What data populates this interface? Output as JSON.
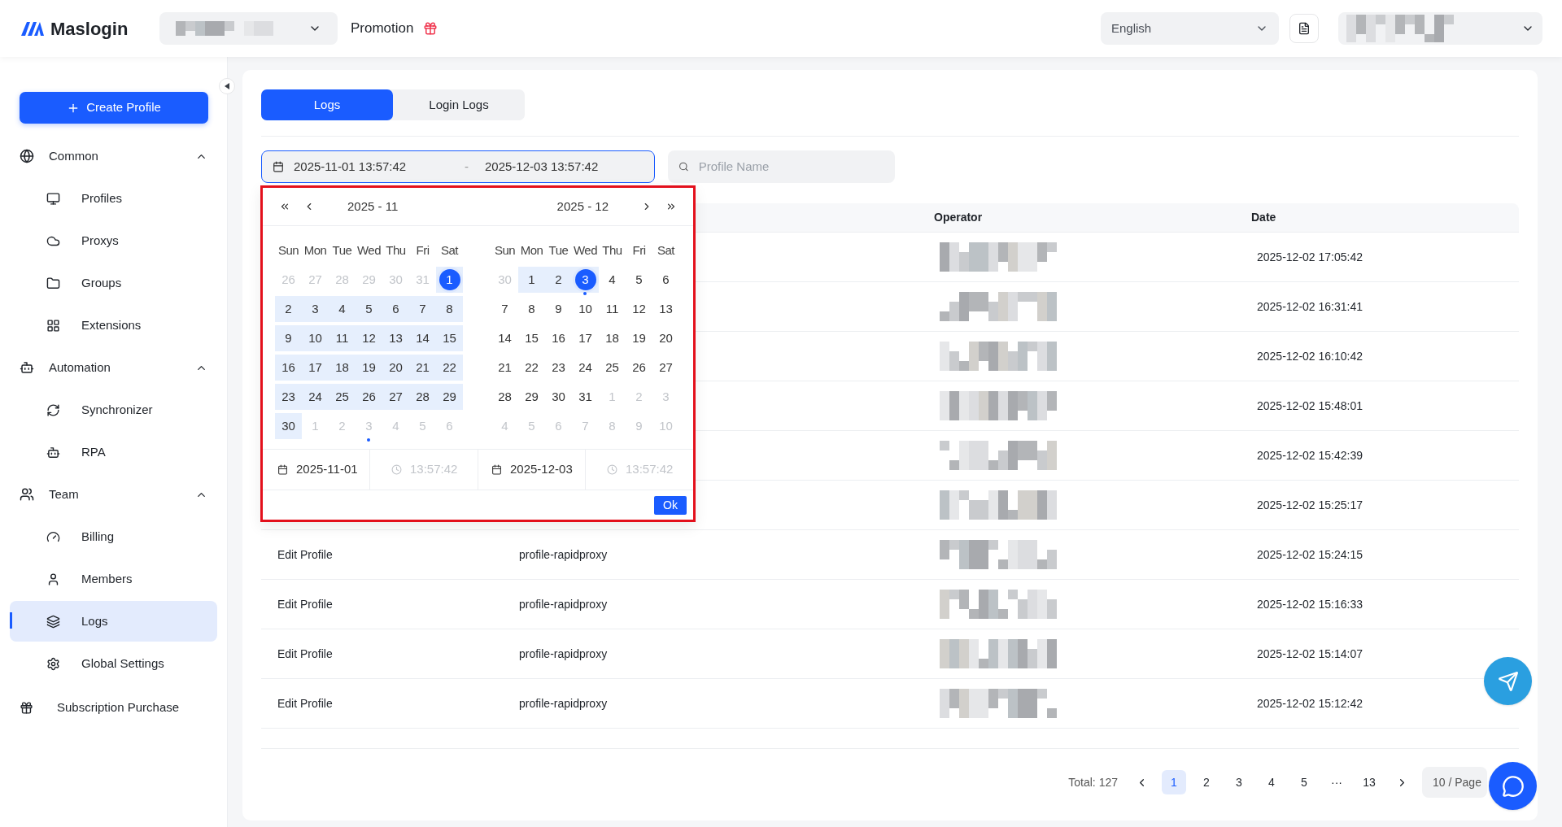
{
  "brand": "Maslogin",
  "header": {
    "promotion": "Promotion",
    "language": "English"
  },
  "sidebar": {
    "create_button": "Create Profile",
    "groups": [
      {
        "label": "Common",
        "expanded": true,
        "items": [
          {
            "label": "Profiles",
            "selected": false
          },
          {
            "label": "Proxys",
            "selected": false
          },
          {
            "label": "Groups",
            "selected": false
          },
          {
            "label": "Extensions",
            "selected": false
          }
        ]
      },
      {
        "label": "Automation",
        "expanded": true,
        "items": [
          {
            "label": "Synchronizer",
            "selected": false
          },
          {
            "label": "RPA",
            "selected": false
          }
        ]
      },
      {
        "label": "Team",
        "expanded": true,
        "items": [
          {
            "label": "Billing",
            "selected": false
          },
          {
            "label": "Members",
            "selected": false
          },
          {
            "label": "Logs",
            "selected": true
          },
          {
            "label": "Global Settings",
            "selected": false
          }
        ]
      }
    ],
    "bottom_item": "Subscription Purchase"
  },
  "tabs": [
    {
      "label": "Logs",
      "selected": true
    },
    {
      "label": "Login Logs",
      "selected": false
    }
  ],
  "date_range": {
    "start": "2025-11-01 13:57:42",
    "separator": "-",
    "end": "2025-12-03 13:57:42"
  },
  "search": {
    "placeholder": "Profile Name"
  },
  "picker": {
    "panels": [
      {
        "title": "2025 - 11",
        "weekdays": [
          "Sun",
          "Mon",
          "Tue",
          "Wed",
          "Thu",
          "Fri",
          "Sat"
        ],
        "weeks": [
          [
            {
              "d": "26",
              "muted": true,
              "in_range": false,
              "selected": false,
              "today": false
            },
            {
              "d": "27",
              "muted": true,
              "in_range": false,
              "selected": false,
              "today": false
            },
            {
              "d": "28",
              "muted": true,
              "in_range": false,
              "selected": false,
              "today": false
            },
            {
              "d": "29",
              "muted": true,
              "in_range": false,
              "selected": false,
              "today": false
            },
            {
              "d": "30",
              "muted": true,
              "in_range": false,
              "selected": false,
              "today": false
            },
            {
              "d": "31",
              "muted": true,
              "in_range": false,
              "selected": false,
              "today": false
            },
            {
              "d": "1",
              "muted": false,
              "in_range": true,
              "selected": true,
              "today": false
            }
          ],
          [
            {
              "d": "2",
              "muted": false,
              "in_range": true,
              "selected": false,
              "today": false
            },
            {
              "d": "3",
              "muted": false,
              "in_range": true,
              "selected": false,
              "today": false
            },
            {
              "d": "4",
              "muted": false,
              "in_range": true,
              "selected": false,
              "today": false
            },
            {
              "d": "5",
              "muted": false,
              "in_range": true,
              "selected": false,
              "today": false
            },
            {
              "d": "6",
              "muted": false,
              "in_range": true,
              "selected": false,
              "today": false
            },
            {
              "d": "7",
              "muted": false,
              "in_range": true,
              "selected": false,
              "today": false
            },
            {
              "d": "8",
              "muted": false,
              "in_range": true,
              "selected": false,
              "today": false
            }
          ],
          [
            {
              "d": "9",
              "muted": false,
              "in_range": true,
              "selected": false,
              "today": false
            },
            {
              "d": "10",
              "muted": false,
              "in_range": true,
              "selected": false,
              "today": false
            },
            {
              "d": "11",
              "muted": false,
              "in_range": true,
              "selected": false,
              "today": false
            },
            {
              "d": "12",
              "muted": false,
              "in_range": true,
              "selected": false,
              "today": false
            },
            {
              "d": "13",
              "muted": false,
              "in_range": true,
              "selected": false,
              "today": false
            },
            {
              "d": "14",
              "muted": false,
              "in_range": true,
              "selected": false,
              "today": false
            },
            {
              "d": "15",
              "muted": false,
              "in_range": true,
              "selected": false,
              "today": false
            }
          ],
          [
            {
              "d": "16",
              "muted": false,
              "in_range": true,
              "selected": false,
              "today": false
            },
            {
              "d": "17",
              "muted": false,
              "in_range": true,
              "selected": false,
              "today": false
            },
            {
              "d": "18",
              "muted": false,
              "in_range": true,
              "selected": false,
              "today": false
            },
            {
              "d": "19",
              "muted": false,
              "in_range": true,
              "selected": false,
              "today": false
            },
            {
              "d": "20",
              "muted": false,
              "in_range": true,
              "selected": false,
              "today": false
            },
            {
              "d": "21",
              "muted": false,
              "in_range": true,
              "selected": false,
              "today": false
            },
            {
              "d": "22",
              "muted": false,
              "in_range": true,
              "selected": false,
              "today": false
            }
          ],
          [
            {
              "d": "23",
              "muted": false,
              "in_range": true,
              "selected": false,
              "today": false
            },
            {
              "d": "24",
              "muted": false,
              "in_range": true,
              "selected": false,
              "today": false
            },
            {
              "d": "25",
              "muted": false,
              "in_range": true,
              "selected": false,
              "today": false
            },
            {
              "d": "26",
              "muted": false,
              "in_range": true,
              "selected": false,
              "today": false
            },
            {
              "d": "27",
              "muted": false,
              "in_range": true,
              "selected": false,
              "today": false
            },
            {
              "d": "28",
              "muted": false,
              "in_range": true,
              "selected": false,
              "today": false
            },
            {
              "d": "29",
              "muted": false,
              "in_range": true,
              "selected": false,
              "today": false
            }
          ],
          [
            {
              "d": "30",
              "muted": false,
              "in_range": true,
              "selected": false,
              "today": false
            },
            {
              "d": "1",
              "muted": true,
              "in_range": false,
              "selected": false,
              "today": false
            },
            {
              "d": "2",
              "muted": true,
              "in_range": false,
              "selected": false,
              "today": false
            },
            {
              "d": "3",
              "muted": true,
              "in_range": false,
              "selected": false,
              "today": true
            },
            {
              "d": "4",
              "muted": true,
              "in_range": false,
              "selected": false,
              "today": false
            },
            {
              "d": "5",
              "muted": true,
              "in_range": false,
              "selected": false,
              "today": false
            },
            {
              "d": "6",
              "muted": true,
              "in_range": false,
              "selected": false,
              "today": false
            }
          ]
        ]
      },
      {
        "title": "2025 - 12",
        "weekdays": [
          "Sun",
          "Mon",
          "Tue",
          "Wed",
          "Thu",
          "Fri",
          "Sat"
        ],
        "weeks": [
          [
            {
              "d": "30",
              "muted": true,
              "in_range": false,
              "selected": false,
              "today": false
            },
            {
              "d": "1",
              "muted": false,
              "in_range": true,
              "selected": false,
              "today": false
            },
            {
              "d": "2",
              "muted": false,
              "in_range": true,
              "selected": false,
              "today": false
            },
            {
              "d": "3",
              "muted": false,
              "in_range": true,
              "selected": true,
              "today": true
            },
            {
              "d": "4",
              "muted": false,
              "in_range": false,
              "selected": false,
              "today": false
            },
            {
              "d": "5",
              "muted": false,
              "in_range": false,
              "selected": false,
              "today": false
            },
            {
              "d": "6",
              "muted": false,
              "in_range": false,
              "selected": false,
              "today": false
            }
          ],
          [
            {
              "d": "7",
              "muted": false,
              "in_range": false,
              "selected": false,
              "today": false
            },
            {
              "d": "8",
              "muted": false,
              "in_range": false,
              "selected": false,
              "today": false
            },
            {
              "d": "9",
              "muted": false,
              "in_range": false,
              "selected": false,
              "today": false
            },
            {
              "d": "10",
              "muted": false,
              "in_range": false,
              "selected": false,
              "today": false
            },
            {
              "d": "11",
              "muted": false,
              "in_range": false,
              "selected": false,
              "today": false
            },
            {
              "d": "12",
              "muted": false,
              "in_range": false,
              "selected": false,
              "today": false
            },
            {
              "d": "13",
              "muted": false,
              "in_range": false,
              "selected": false,
              "today": false
            }
          ],
          [
            {
              "d": "14",
              "muted": false,
              "in_range": false,
              "selected": false,
              "today": false
            },
            {
              "d": "15",
              "muted": false,
              "in_range": false,
              "selected": false,
              "today": false
            },
            {
              "d": "16",
              "muted": false,
              "in_range": false,
              "selected": false,
              "today": false
            },
            {
              "d": "17",
              "muted": false,
              "in_range": false,
              "selected": false,
              "today": false
            },
            {
              "d": "18",
              "muted": false,
              "in_range": false,
              "selected": false,
              "today": false
            },
            {
              "d": "19",
              "muted": false,
              "in_range": false,
              "selected": false,
              "today": false
            },
            {
              "d": "20",
              "muted": false,
              "in_range": false,
              "selected": false,
              "today": false
            }
          ],
          [
            {
              "d": "21",
              "muted": false,
              "in_range": false,
              "selected": false,
              "today": false
            },
            {
              "d": "22",
              "muted": false,
              "in_range": false,
              "selected": false,
              "today": false
            },
            {
              "d": "23",
              "muted": false,
              "in_range": false,
              "selected": false,
              "today": false
            },
            {
              "d": "24",
              "muted": false,
              "in_range": false,
              "selected": false,
              "today": false
            },
            {
              "d": "25",
              "muted": false,
              "in_range": false,
              "selected": false,
              "today": false
            },
            {
              "d": "26",
              "muted": false,
              "in_range": false,
              "selected": false,
              "today": false
            },
            {
              "d": "27",
              "muted": false,
              "in_range": false,
              "selected": false,
              "today": false
            }
          ],
          [
            {
              "d": "28",
              "muted": false,
              "in_range": false,
              "selected": false,
              "today": false
            },
            {
              "d": "29",
              "muted": false,
              "in_range": false,
              "selected": false,
              "today": false
            },
            {
              "d": "30",
              "muted": false,
              "in_range": false,
              "selected": false,
              "today": false
            },
            {
              "d": "31",
              "muted": false,
              "in_range": false,
              "selected": false,
              "today": false
            },
            {
              "d": "1",
              "muted": true,
              "in_range": false,
              "selected": false,
              "today": false
            },
            {
              "d": "2",
              "muted": true,
              "in_range": false,
              "selected": false,
              "today": false
            },
            {
              "d": "3",
              "muted": true,
              "in_range": false,
              "selected": false,
              "today": false
            }
          ],
          [
            {
              "d": "4",
              "muted": true,
              "in_range": false,
              "selected": false,
              "today": false
            },
            {
              "d": "5",
              "muted": true,
              "in_range": false,
              "selected": false,
              "today": false
            },
            {
              "d": "6",
              "muted": true,
              "in_range": false,
              "selected": false,
              "today": false
            },
            {
              "d": "7",
              "muted": true,
              "in_range": false,
              "selected": false,
              "today": false
            },
            {
              "d": "8",
              "muted": true,
              "in_range": false,
              "selected": false,
              "today": false
            },
            {
              "d": "9",
              "muted": true,
              "in_range": false,
              "selected": false,
              "today": false
            },
            {
              "d": "10",
              "muted": true,
              "in_range": false,
              "selected": false,
              "today": false
            }
          ]
        ]
      }
    ],
    "footer": {
      "start_date": "2025-11-01",
      "start_time": "13:57:42",
      "end_date": "2025-12-03",
      "end_time": "13:57:42"
    },
    "ok_button": "Ok"
  },
  "table": {
    "columns": [
      "Operator",
      "Date"
    ],
    "rows": [
      {
        "date": "2025-12-02 17:05:42"
      },
      {
        "date": "2025-12-02 16:31:41"
      },
      {
        "date": "2025-12-02 16:10:42"
      },
      {
        "date": "2025-12-02 15:48:01"
      },
      {
        "date": "2025-12-02 15:42:39"
      },
      {
        "date": "2025-12-02 15:25:17"
      },
      {
        "action": "Edit Profile",
        "profile": "profile-rapidproxy",
        "date": "2025-12-02 15:24:15"
      },
      {
        "action": "Edit Profile",
        "profile": "profile-rapidproxy",
        "date": "2025-12-02 15:16:33"
      },
      {
        "action": "Edit Profile",
        "profile": "profile-rapidproxy",
        "date": "2025-12-02 15:14:07"
      },
      {
        "action": "Edit Profile",
        "profile": "profile-rapidproxy",
        "date": "2025-12-02 15:12:42"
      }
    ]
  },
  "pagination": {
    "total": "Total: 127",
    "pages": [
      {
        "label": "1",
        "selected": true
      },
      {
        "label": "2",
        "selected": false
      },
      {
        "label": "3",
        "selected": false
      },
      {
        "label": "4",
        "selected": false
      },
      {
        "label": "5",
        "selected": false
      },
      {
        "label": "···",
        "selected": false
      },
      {
        "label": "13",
        "selected": false
      }
    ],
    "page_size": "10 / Page"
  }
}
